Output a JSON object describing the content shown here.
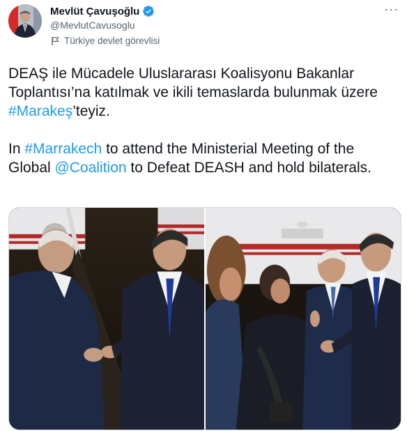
{
  "author": {
    "name": "Mevlüt Çavuşoğlu",
    "handle": "@MevlutCavusoglu",
    "account_label": "Türkiye devlet görevlisi",
    "verified_icon": "verified-badge-icon"
  },
  "tweet": {
    "tr_before_link": "DEAŞ ile Mücadele Uluslararası Koalisyonu Bakanlar Toplantısı’na katılmak ve ikili temaslarda bulunmak üzere ",
    "tr_link": "#Marakeş",
    "tr_after_link": "’teyiz.",
    "en_in": "In ",
    "en_link1": "#Marrakech",
    "en_middle": " to attend the Ministerial Meeting of the Global ",
    "en_link2": "@Coalition",
    "en_after": " to Defeat DEASH and hold bilaterals."
  },
  "media": {
    "photos": [
      {
        "name": "photo-1"
      },
      {
        "name": "photo-2"
      }
    ]
  },
  "colors": {
    "link": "#1d9bf0",
    "secondary_text": "#536471",
    "verified": "#1d9bf0"
  }
}
